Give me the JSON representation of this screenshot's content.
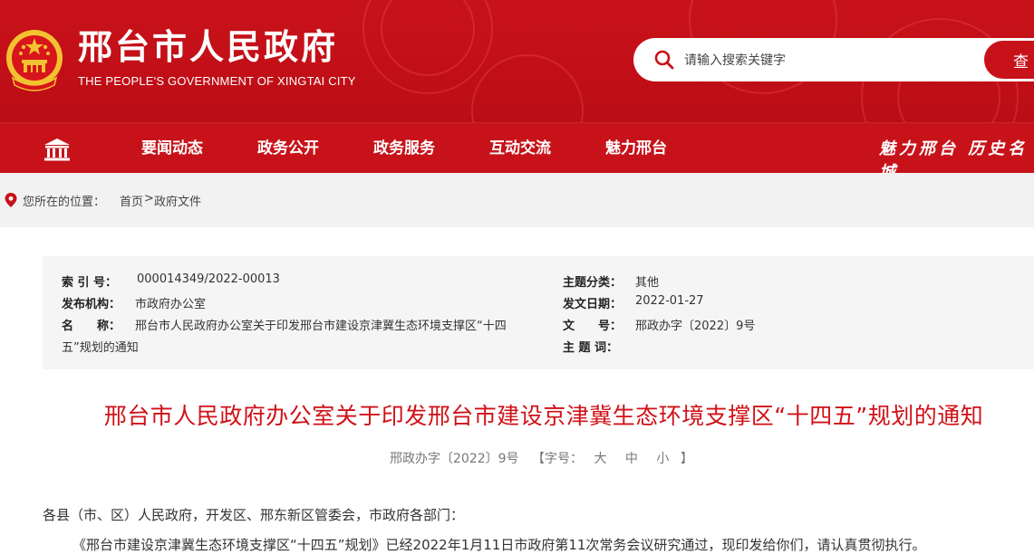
{
  "header": {
    "title": "邢台市人民政府",
    "subtitle": "THE PEOPLE'S GOVERNMENT OF XINGTAI CITY",
    "search_placeholder": "请输入搜索关键字",
    "search_button": "查"
  },
  "nav": {
    "items": [
      "要闻动态",
      "政务公开",
      "政务服务",
      "互动交流",
      "魅力邢台"
    ],
    "slogan": "魅力邢台 历史名城"
  },
  "breadcrumb": {
    "label": "您所在的位置：",
    "home": "首页",
    "separator": ">",
    "current": "政府文件"
  },
  "meta": {
    "index_label": "索 引 号：",
    "index_value": "000014349/2022-00013",
    "org_label": "发布机构：",
    "org_value": "市政府办公室",
    "name_label": "名　　称：",
    "name_value_line1": "邢台市人民政府办公室关于印发邢台市建设京津冀生态环境支撑区“十四",
    "name_value_line2": "五”规划的通知",
    "category_label": "主题分类：",
    "category_value": "其他",
    "date_label": "发文日期：",
    "date_value": "2022-01-27",
    "doc_label": "文　　号：",
    "doc_value": "邢政办字〔2022〕9号",
    "keywords_label": "主 题 词："
  },
  "article": {
    "title": "邢台市人民政府办公室关于印发邢台市建设京津冀生态环境支撑区“十四五”规划的通知",
    "doc_number": "邢政办字〔2022〕9号",
    "font_prefix": "【字号：",
    "font_large": "大",
    "font_medium": "中",
    "font_small": "小",
    "font_suffix": "】",
    "para1": "各县（市、区）人民政府，开发区、邢东新区管委会，市政府各部门：",
    "para2": "《邢台市建设京津冀生态环境支撑区“十四五”规划》已经2022年1月11日市政府第11次常务会议研究通过，现印发给你们，请认真贯彻执行。"
  },
  "colors": {
    "brand_red": "#c8121a",
    "title_red": "#d01017"
  }
}
